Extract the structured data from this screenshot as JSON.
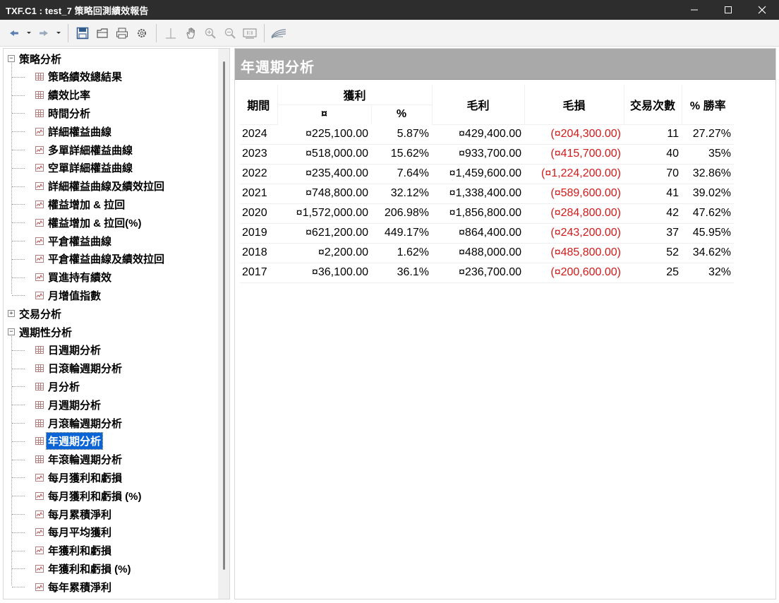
{
  "window": {
    "title": "TXF.C1 : test_7 策略回測績效報告"
  },
  "tree": {
    "groups": [
      {
        "label": "策略分析",
        "expander": "−",
        "items": [
          {
            "label": "策略績效總結果",
            "icon": "table-icon"
          },
          {
            "label": "績效比率",
            "icon": "table-icon"
          },
          {
            "label": "時間分析",
            "icon": "table-icon"
          },
          {
            "label": "詳細權益曲線",
            "icon": "chart-icon"
          },
          {
            "label": "多單詳細權益曲線",
            "icon": "chart-icon"
          },
          {
            "label": "空單詳細權益曲線",
            "icon": "chart-icon"
          },
          {
            "label": "詳細權益曲線及績效拉回",
            "icon": "chart-icon"
          },
          {
            "label": "權益增加 & 拉回",
            "icon": "chart-icon"
          },
          {
            "label": "權益增加 & 拉回(%)",
            "icon": "chart-icon"
          },
          {
            "label": "平倉權益曲線",
            "icon": "chart-icon"
          },
          {
            "label": "平倉權益曲線及績效拉回",
            "icon": "chart-icon"
          },
          {
            "label": "買進持有績效",
            "icon": "chart-icon"
          },
          {
            "label": "月增值指數",
            "icon": "chart-icon"
          }
        ]
      },
      {
        "label": "交易分析",
        "expander": "+",
        "items": []
      },
      {
        "label": "週期性分析",
        "expander": "−",
        "items": [
          {
            "label": "日週期分析",
            "icon": "table-icon"
          },
          {
            "label": "日滾輪週期分析",
            "icon": "table-icon"
          },
          {
            "label": "月分析",
            "icon": "table-icon"
          },
          {
            "label": "月週期分析",
            "icon": "table-icon"
          },
          {
            "label": "月滾輪週期分析",
            "icon": "table-icon"
          },
          {
            "label": "年週期分析",
            "icon": "table-icon",
            "selected": true
          },
          {
            "label": "年滾輪週期分析",
            "icon": "table-icon"
          },
          {
            "label": "每月獲利和虧損",
            "icon": "chart-icon"
          },
          {
            "label": "每月獲利和虧損 (%)",
            "icon": "chart-icon"
          },
          {
            "label": "每月累積淨利",
            "icon": "chart-icon"
          },
          {
            "label": "每月平均獲利",
            "icon": "chart-icon"
          },
          {
            "label": "年獲利和虧損",
            "icon": "chart-icon"
          },
          {
            "label": "年獲利和虧損 (%)",
            "icon": "chart-icon"
          },
          {
            "label": "每年累積淨利",
            "icon": "chart-icon"
          }
        ]
      }
    ]
  },
  "content": {
    "title": "年週期分析",
    "table": {
      "headers": {
        "period": "期間",
        "profit": "獲利",
        "profit_amount": "¤",
        "profit_pct": "%",
        "gross_profit": "毛利",
        "gross_loss": "毛損",
        "trades": "交易次數",
        "win_rate": "% 勝率"
      },
      "rows": [
        {
          "period": "2024",
          "profit": "¤225,100.00",
          "pct": "5.87%",
          "gross_profit": "¤429,400.00",
          "gross_loss": "(¤204,300.00)",
          "trades": "11",
          "win_rate": "27.27%"
        },
        {
          "period": "2023",
          "profit": "¤518,000.00",
          "pct": "15.62%",
          "gross_profit": "¤933,700.00",
          "gross_loss": "(¤415,700.00)",
          "trades": "40",
          "win_rate": "35%"
        },
        {
          "period": "2022",
          "profit": "¤235,400.00",
          "pct": "7.64%",
          "gross_profit": "¤1,459,600.00",
          "gross_loss": "(¤1,224,200.00)",
          "trades": "70",
          "win_rate": "32.86%"
        },
        {
          "period": "2021",
          "profit": "¤748,800.00",
          "pct": "32.12%",
          "gross_profit": "¤1,338,400.00",
          "gross_loss": "(¤589,600.00)",
          "trades": "41",
          "win_rate": "39.02%"
        },
        {
          "period": "2020",
          "profit": "¤1,572,000.00",
          "pct": "206.98%",
          "gross_profit": "¤1,856,800.00",
          "gross_loss": "(¤284,800.00)",
          "trades": "42",
          "win_rate": "47.62%"
        },
        {
          "period": "2019",
          "profit": "¤621,200.00",
          "pct": "449.17%",
          "gross_profit": "¤864,400.00",
          "gross_loss": "(¤243,200.00)",
          "trades": "37",
          "win_rate": "45.95%"
        },
        {
          "period": "2018",
          "profit": "¤2,200.00",
          "pct": "1.62%",
          "gross_profit": "¤488,000.00",
          "gross_loss": "(¤485,800.00)",
          "trades": "52",
          "win_rate": "34.62%"
        },
        {
          "period": "2017",
          "profit": "¤36,100.00",
          "pct": "36.1%",
          "gross_profit": "¤236,700.00",
          "gross_loss": "(¤200,600.00)",
          "trades": "25",
          "win_rate": "32%"
        }
      ]
    }
  },
  "colors": {
    "titlebar": "#2d2d2d",
    "selection": "#0a64d6",
    "header_band": "#a9a9a9",
    "loss": "#d11a1a"
  }
}
